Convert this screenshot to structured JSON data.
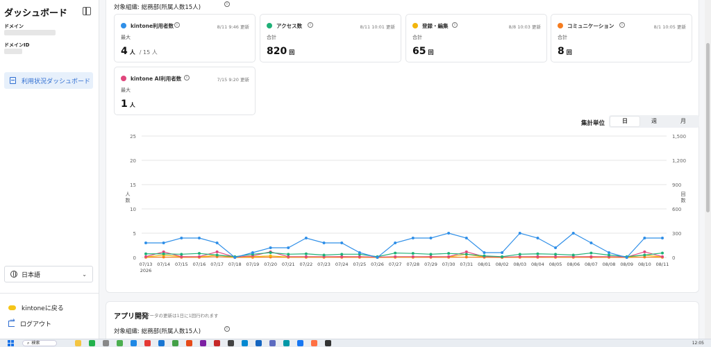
{
  "sidebar": {
    "title": "ダッシュボード",
    "domain_label": "ドメイン",
    "domain_id_label": "ドメインID",
    "nav_item": "利用状況ダッシュボード",
    "language": "日本語",
    "back_to_kintone": "kintoneに戻る",
    "logout": "ログアウト"
  },
  "header": {
    "org": "対象組織: 総務部(所属人数15人)"
  },
  "cards": [
    {
      "title": "kintone利用者数",
      "updated": "8/11 9:46 更新",
      "sub": "最大",
      "value": "4",
      "unit": "人",
      "extra": "/ 15 人",
      "color": "#2f8fe8"
    },
    {
      "title": "アクセス数",
      "updated": "8/11 10:01 更新",
      "sub": "合計",
      "value": "820",
      "unit": "回",
      "extra": "",
      "color": "#1fb077"
    },
    {
      "title": "登録・編集",
      "updated": "8/8 10:03 更新",
      "sub": "合計",
      "value": "65",
      "unit": "回",
      "extra": "",
      "color": "#f2b50d"
    },
    {
      "title": "コミュニケーション",
      "updated": "8/1 10:05 更新",
      "sub": "合計",
      "value": "8",
      "unit": "回",
      "extra": "",
      "color": "#f57c1f"
    },
    {
      "title": "kintone AI利用者数",
      "updated": "7/15 9:20 更新",
      "sub": "最大",
      "value": "1",
      "unit": "人",
      "extra": "",
      "color": "#e0467c"
    }
  ],
  "controls": {
    "unit_label": "集計単位",
    "options": [
      "日",
      "週",
      "月"
    ]
  },
  "chart_data": {
    "type": "line",
    "x": [
      "07/13",
      "07/14",
      "07/15",
      "07/16",
      "07/17",
      "07/18",
      "07/19",
      "07/20",
      "07/21",
      "07/22",
      "07/23",
      "07/24",
      "07/25",
      "07/26",
      "07/27",
      "07/28",
      "07/29",
      "07/30",
      "07/31",
      "08/01",
      "08/02",
      "08/03",
      "08/04",
      "08/05",
      "08/06",
      "08/07",
      "08/08",
      "08/09",
      "08/10",
      "08/11"
    ],
    "x_year_label": "2026",
    "ylabel_left": "人数",
    "ylabel_right": "回数",
    "ylim_left": [
      0,
      25
    ],
    "yticks_left": [
      0,
      5,
      10,
      15,
      20,
      25
    ],
    "ylim_right": [
      0,
      1500
    ],
    "yticks_right": [
      "0",
      "300",
      "600",
      "900",
      "1,200",
      "1,500"
    ],
    "grid": true,
    "legend": "none",
    "series": [
      {
        "axis": "left",
        "color": "#2f8fe8",
        "values": [
          3,
          3,
          4,
          4,
          3,
          0,
          1,
          2,
          2,
          4,
          3,
          3,
          1,
          0,
          3,
          4,
          4,
          5,
          4,
          1,
          1,
          5,
          4,
          2,
          5,
          3,
          1,
          0,
          4,
          4
        ]
      },
      {
        "axis": "right",
        "color": "#1fb077",
        "values": [
          45,
          45,
          40,
          50,
          30,
          10,
          40,
          60,
          40,
          45,
          30,
          40,
          40,
          10,
          55,
          50,
          40,
          50,
          40,
          20,
          10,
          40,
          45,
          40,
          30,
          55,
          30,
          10,
          30,
          55
        ]
      },
      {
        "axis": "right",
        "color": "#e0467c",
        "values": [
          10,
          70,
          10,
          10,
          70,
          5,
          20,
          70,
          10,
          10,
          10,
          10,
          10,
          5,
          10,
          10,
          10,
          10,
          70,
          10,
          5,
          10,
          10,
          10,
          10,
          10,
          10,
          5,
          70,
          10
        ]
      },
      {
        "axis": "right",
        "color": "#f2b50d",
        "values": [
          5,
          30,
          10,
          5,
          30,
          2,
          10,
          20,
          5,
          5,
          5,
          10,
          5,
          2,
          5,
          5,
          10,
          5,
          40,
          5,
          2,
          5,
          10,
          5,
          5,
          10,
          5,
          2,
          30,
          5
        ]
      },
      {
        "axis": "right",
        "color": "#f57c1f",
        "values": [
          2,
          5,
          2,
          2,
          10,
          0,
          2,
          5,
          2,
          2,
          2,
          2,
          2,
          0,
          2,
          2,
          2,
          2,
          5,
          2,
          0,
          2,
          2,
          2,
          2,
          2,
          2,
          0,
          5,
          2
        ]
      }
    ]
  },
  "section2": {
    "title": "アプリ開発",
    "note": "データの更新は1日に1回行われます",
    "org": "対象組織: 総務部(所属人数15人)"
  },
  "taskbar": {
    "search": "検索",
    "clock": "12:05"
  }
}
